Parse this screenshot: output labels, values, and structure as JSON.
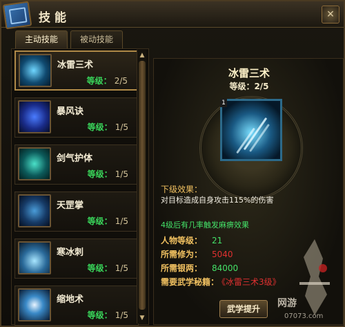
{
  "window": {
    "title": "技能",
    "close_label": "✕"
  },
  "tabs": [
    {
      "label": "主动技能",
      "active": true
    },
    {
      "label": "被动技能",
      "active": false
    }
  ],
  "skills": [
    {
      "name": "冰雷三术",
      "level_label": "等级：",
      "level": "2/5",
      "icon": "ice-lightning-icon"
    },
    {
      "name": "暴风诀",
      "level_label": "等级：",
      "level": "1/5",
      "icon": "storm-icon"
    },
    {
      "name": "剑气护体",
      "level_label": "等级：",
      "level": "1/5",
      "icon": "sword-shield-icon"
    },
    {
      "name": "天罡掌",
      "level_label": "等级：",
      "level": "1/5",
      "icon": "palm-icon"
    },
    {
      "name": "寒冰刺",
      "level_label": "等级：",
      "level": "1/5",
      "icon": "frost-spike-icon"
    },
    {
      "name": "缩地术",
      "level_label": "等级：",
      "level": "1/5",
      "icon": "shrink-earth-icon"
    }
  ],
  "detail": {
    "name": "冰雷三术",
    "level_text": "等级：2/5",
    "badge": "1",
    "next_label": "下级效果：",
    "next_effect": "对目标造成自身攻击115%的伤害",
    "green_note": "4级后有几率触发麻痹效果",
    "requirements": [
      {
        "label": "人物等级：",
        "value": "21",
        "color": "green"
      },
      {
        "label": "所需修为：",
        "value": "5040",
        "color": "red"
      },
      {
        "label": "所需银两：",
        "value": "84000",
        "color": "green"
      },
      {
        "label": "需要武学秘籍：",
        "value": "《冰雷三术3级》",
        "color": "red"
      }
    ],
    "learn_button": "武学提升"
  },
  "watermark": {
    "brand": "网游",
    "url": "07073.com"
  },
  "colors": {
    "accent_gold": "#b08a48",
    "green": "#44e068",
    "red": "#e03030"
  }
}
